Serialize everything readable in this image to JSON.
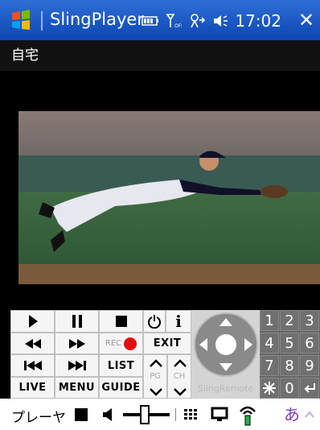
{
  "titlebar": {
    "app_title": "SlingPlayer",
    "clock": "17:02",
    "close": "✕"
  },
  "location": {
    "label": "自宅"
  },
  "controls": {
    "rec_label": "REC",
    "exit_label": "EXIT",
    "list_label": "LIST",
    "live_label": "LIVE",
    "menu_label": "MENU",
    "guide_label": "GUIDE",
    "pg_label": "PG",
    "ch_label": "CH",
    "info_label": "i",
    "brand_label": "SlingRemote"
  },
  "numpad": {
    "keys": [
      "1",
      "2",
      "3",
      "4",
      "5",
      "6",
      "7",
      "8",
      "9",
      "0"
    ]
  },
  "taskbar": {
    "mode_label": "プレーヤ"
  },
  "colors": {
    "titlebar": "#0c46b3",
    "rec_dot": "#e01010",
    "signal": "#22b14c"
  }
}
